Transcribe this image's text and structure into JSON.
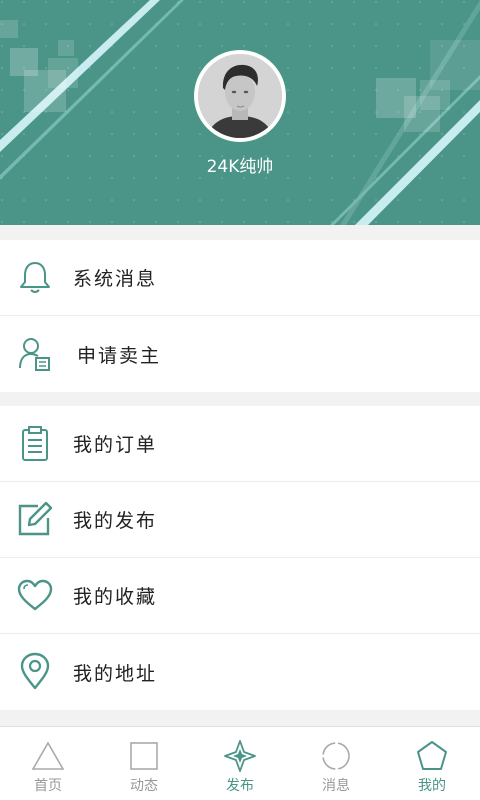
{
  "profile": {
    "username": "24K纯帅"
  },
  "menu_group_1": [
    {
      "label": "系统消息",
      "icon": "bell-icon"
    },
    {
      "label": "申请卖主",
      "icon": "apply-seller-icon"
    }
  ],
  "menu_group_2": [
    {
      "label": "我的订单",
      "icon": "clipboard-icon"
    },
    {
      "label": "我的发布",
      "icon": "edit-icon"
    },
    {
      "label": "我的收藏",
      "icon": "heart-icon"
    },
    {
      "label": "我的地址",
      "icon": "location-pin-icon"
    }
  ],
  "tabbar": [
    {
      "label": "首页",
      "icon": "triangle-icon",
      "active": false
    },
    {
      "label": "动态",
      "icon": "square-icon",
      "active": false
    },
    {
      "label": "发布",
      "icon": "compass-star-icon",
      "active": true
    },
    {
      "label": "消息",
      "icon": "circle-icon",
      "active": false
    },
    {
      "label": "我的",
      "icon": "pentagon-icon",
      "active": true
    }
  ],
  "colors": {
    "accent": "#4a9488",
    "icon_stroke": "#4a9488",
    "inactive": "#999999"
  }
}
